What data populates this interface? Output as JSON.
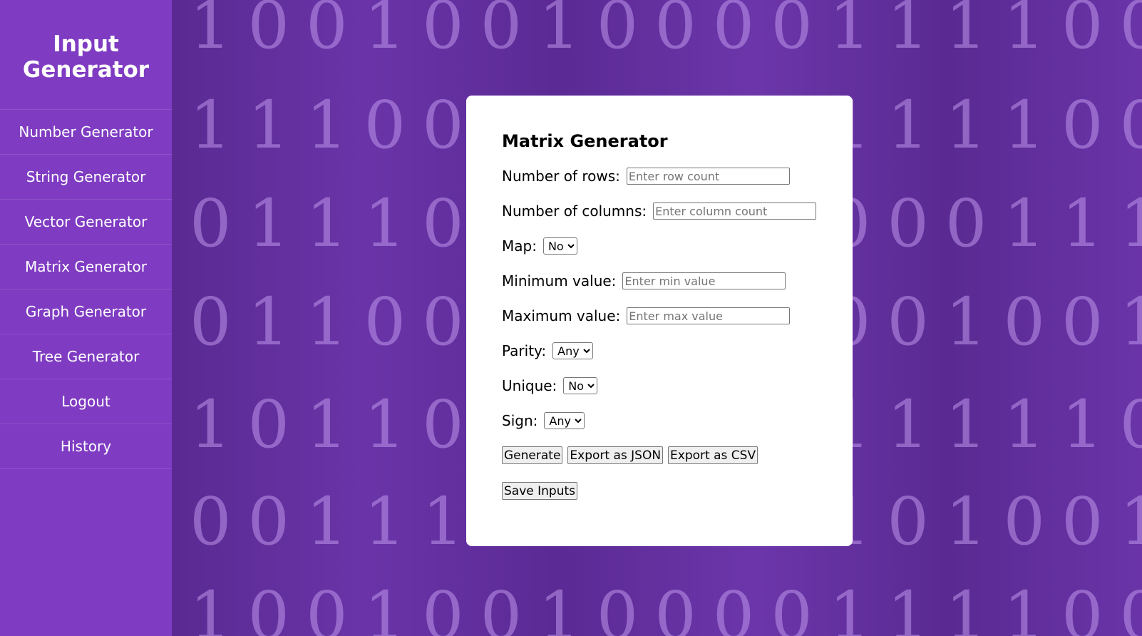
{
  "sidebar": {
    "brand": "Input Generator",
    "items": [
      {
        "label": "Number Generator"
      },
      {
        "label": "String Generator"
      },
      {
        "label": "Vector Generator"
      },
      {
        "label": "Matrix Generator"
      },
      {
        "label": "Graph Generator"
      },
      {
        "label": "Tree Generator"
      },
      {
        "label": "Logout"
      },
      {
        "label": "History"
      }
    ]
  },
  "background": {
    "rows": [
      "10010010000111100",
      "11100000000111100",
      "01110100000000111",
      "01100100000001001",
      "10110101111111110",
      "00111010011101001",
      "10010010000111100"
    ]
  },
  "form": {
    "title": "Matrix Generator",
    "rows": {
      "label": "Number of rows:",
      "placeholder": "Enter row count"
    },
    "columns": {
      "label": "Number of columns:",
      "placeholder": "Enter column count"
    },
    "map": {
      "label": "Map:",
      "value": "No"
    },
    "min": {
      "label": "Minimum value:",
      "placeholder": "Enter min value"
    },
    "max": {
      "label": "Maximum value:",
      "placeholder": "Enter max value"
    },
    "parity": {
      "label": "Parity:",
      "value": "Any"
    },
    "unique": {
      "label": "Unique:",
      "value": "No"
    },
    "sign": {
      "label": "Sign:",
      "value": "Any"
    },
    "buttons": {
      "generate": "Generate",
      "export_json": "Export as JSON",
      "export_csv": "Export as CSV",
      "save_inputs": "Save Inputs"
    }
  }
}
